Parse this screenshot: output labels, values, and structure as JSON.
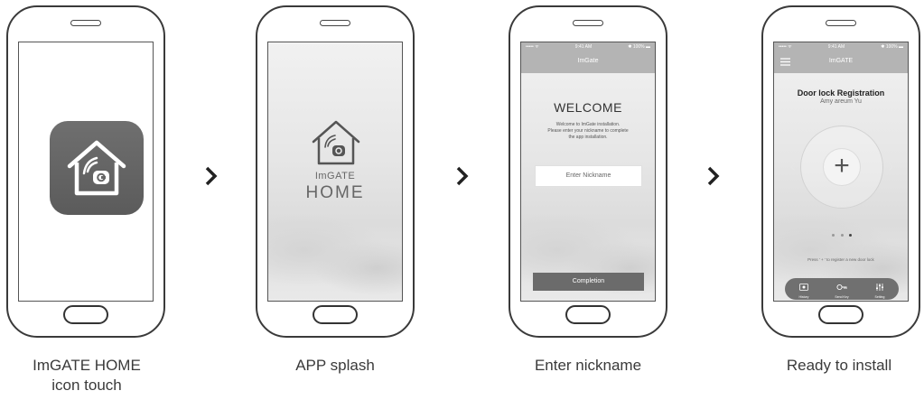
{
  "steps": [
    {
      "caption_line1": "ImGATE HOME",
      "caption_line2": "icon touch"
    },
    {
      "caption": "APP splash",
      "logo_line1": "ImGATE",
      "logo_line2": "HOME"
    },
    {
      "caption": "Enter nickname",
      "status_left": "••••• ᯤ",
      "status_time": "9:41 AM",
      "status_right": "✱ 100% ▬",
      "appbar_title": "ImGate",
      "heading": "WELCOME",
      "text1": "Welcome to ImGate installation.",
      "text2": "Please enter your nickname to complete",
      "text3": "the app installation.",
      "input_placeholder": "Enter Nickname",
      "button_label": "Completion"
    },
    {
      "caption": "Ready to install",
      "status_left": "••••• ᯤ",
      "status_time": "9:41 AM",
      "status_right": "✱ 100% ▬",
      "appbar_title": "ImGATE",
      "heading": "Door lock Registration",
      "subheading": "Amy areum Yu",
      "plus_symbol": "+",
      "hint": "Press ' + ' to register a new door lock",
      "nav": [
        {
          "label": "History",
          "icon": "history-icon"
        },
        {
          "label": "Send Key",
          "icon": "key-icon"
        },
        {
          "label": "Setting",
          "icon": "sliders-icon"
        }
      ]
    }
  ],
  "colors": {
    "frame": "#3a3a3a",
    "appbar": "#b4b4b4",
    "button": "#6b6b6b",
    "app_icon": "#666666"
  }
}
